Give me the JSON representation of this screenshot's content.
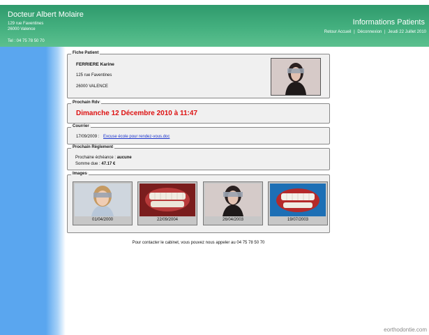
{
  "header": {
    "doctor_name": "Docteur Albert Molaire",
    "address_line1": "129 rue Faventines",
    "address_line2": "26000 Valence",
    "phone": "Tel : 04 75 78 50 70",
    "app_title": "Informations Patients",
    "links": {
      "home": "Retour Accueil",
      "logout": "Déconnexion",
      "date": "Jeudi 22 Juillet 2010",
      "separator": "|"
    }
  },
  "patient": {
    "legend": "Fiche Patient",
    "name": "FERRIERE Karine",
    "street": "125 rue Faventines",
    "city": "26000 VALENCE"
  },
  "appointment": {
    "legend": "Prochain Rdv",
    "text": "Dimanche 12 Décembre 2010 à 11:47"
  },
  "mail": {
    "legend": "Courrier",
    "date": "17/09/2009 :",
    "link": "Excuse école pour rendez-vous.doc"
  },
  "payment": {
    "legend": "Prochain Règlement",
    "due_label": "Prochaine échéance :",
    "due_value": "aucune",
    "amount_label": "Somme due :",
    "amount_value": "47.17 €"
  },
  "images": {
    "legend": "Images",
    "items": [
      {
        "date": "01/04/2000",
        "kind": "child-portrait"
      },
      {
        "date": "22/09/2004",
        "kind": "teeth"
      },
      {
        "date": "26/04/2003",
        "kind": "woman-portrait"
      },
      {
        "date": "19/07/2003",
        "kind": "teeth-blue"
      }
    ]
  },
  "footer": "Pour contacter le cabinet, vous pouvez nous appeler au 04 75 78 50 70",
  "watermark": "eorthodontie.com",
  "colors": {
    "header_green": "#44b07f",
    "sidebar_blue": "#5aa6ef",
    "appointment_red": "#dd1010",
    "link_blue": "#1a33cc"
  }
}
